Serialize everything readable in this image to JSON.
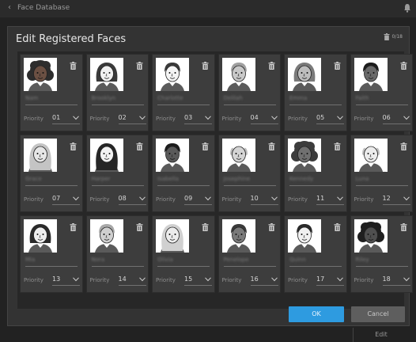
{
  "app": {
    "title": "Face Database",
    "behind_button": "Edit"
  },
  "dialog": {
    "title": "Edit Registered Faces",
    "count": "0/18",
    "priority_label": "Priority",
    "ok_label": "OK",
    "cancel_label": "Cancel"
  },
  "faces": [
    {
      "name": "Nam",
      "priority": "01",
      "hair": "#2d2d2d",
      "skin": "#6b5043",
      "style": "curly"
    },
    {
      "name": "Brooklyn",
      "priority": "02",
      "hair": "#3a3a3a",
      "skin": "#f0f0f0",
      "style": "bob"
    },
    {
      "name": "Charlotte",
      "priority": "03",
      "hair": "#3a3a3a",
      "skin": "#f4f4f4",
      "style": "short"
    },
    {
      "name": "Delilah",
      "priority": "04",
      "hair": "#a0a0a0",
      "skin": "#c8c8c8",
      "style": "short"
    },
    {
      "name": "Emma",
      "priority": "05",
      "hair": "#7a7a7a",
      "skin": "#bdbdbd",
      "style": "bob"
    },
    {
      "name": "Faith",
      "priority": "06",
      "hair": "#1c1c1c",
      "skin": "#6a6a6a",
      "style": "short"
    },
    {
      "name": "Grace",
      "priority": "07",
      "hair": "#c4c4c4",
      "skin": "#e6e6e6",
      "style": "long"
    },
    {
      "name": "Harper",
      "priority": "08",
      "hair": "#262626",
      "skin": "#f2f2f2",
      "style": "long"
    },
    {
      "name": "Isabella",
      "priority": "09",
      "hair": "#1c1c1c",
      "skin": "#5a5a5a",
      "style": "short"
    },
    {
      "name": "Josephine",
      "priority": "10",
      "hair": "#bdbdbd",
      "skin": "#d4d4d4",
      "style": "bald"
    },
    {
      "name": "Kennedy",
      "priority": "11",
      "hair": "#3c3c3c",
      "skin": "#707070",
      "style": "curly"
    },
    {
      "name": "Luna",
      "priority": "12",
      "hair": "#c0c0c0",
      "skin": "#ececec",
      "style": "bald"
    },
    {
      "name": "Mia",
      "priority": "13",
      "hair": "#2a2a2a",
      "skin": "#ededed",
      "style": "bob"
    },
    {
      "name": "Nora",
      "priority": "14",
      "hair": "#a8a8a8",
      "skin": "#cfcfcf",
      "style": "short"
    },
    {
      "name": "Olivia",
      "priority": "15",
      "hair": "#d0d0d0",
      "skin": "#ececec",
      "style": "long"
    },
    {
      "name": "Penelope",
      "priority": "16",
      "hair": "#3a3a3a",
      "skin": "#7a7a7a",
      "style": "short"
    },
    {
      "name": "Quinn",
      "priority": "17",
      "hair": "#2a2a2a",
      "skin": "#f0f0f0",
      "style": "short"
    },
    {
      "name": "Riley",
      "priority": "18",
      "hair": "#1f1f1f",
      "skin": "#4f4f4f",
      "style": "curly"
    }
  ]
}
